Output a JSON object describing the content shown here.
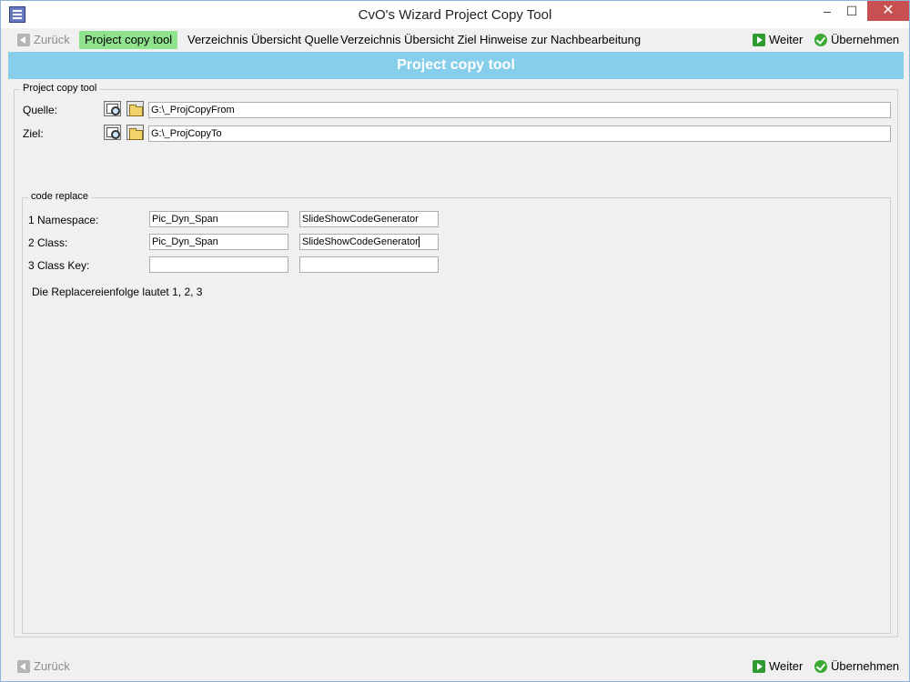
{
  "window": {
    "title": "CvO's Wizard Project Copy Tool"
  },
  "nav": {
    "back_label": "Zurück",
    "tabs": [
      {
        "label": "Project copy tool"
      },
      {
        "label": "Verzeichnis Übersicht Quelle"
      },
      {
        "label": "Verzeichnis Übersicht Ziel"
      },
      {
        "label": "Hinweise zur Nachbearbeitung"
      }
    ],
    "next_label": "Weiter",
    "apply_label": "Übernehmen"
  },
  "header": {
    "title": "Project copy tool"
  },
  "copy_group": {
    "legend": "Project copy tool",
    "source_label": "Quelle:",
    "source_value": "G:\\_ProjCopyFrom",
    "target_label": "Ziel:",
    "target_value": "G:\\_ProjCopyTo"
  },
  "replace_group": {
    "legend": "code replace",
    "rows": [
      {
        "label": "1 Namespace:",
        "from": "Pic_Dyn_Span",
        "to": "SlideShowCodeGenerator"
      },
      {
        "label": "2 Class:",
        "from": "Pic_Dyn_Span",
        "to": "SlideShowCodeGenerator"
      },
      {
        "label": "3 Class Key:",
        "from": "",
        "to": ""
      }
    ],
    "note": "Die Replacereienfolge lautet 1, 2, 3"
  },
  "footer": {
    "back_label": "Zurück",
    "next_label": "Weiter",
    "apply_label": "Übernehmen"
  }
}
